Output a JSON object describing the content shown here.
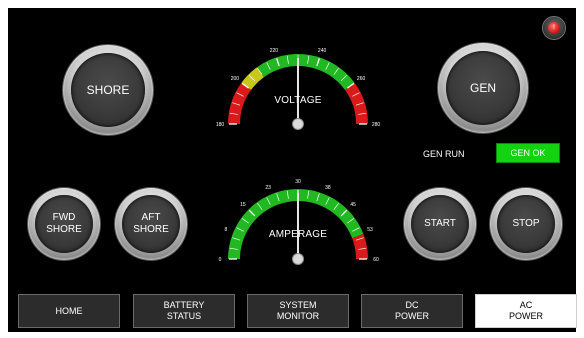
{
  "left_buttons": {
    "shore": "SHORE",
    "fwd_shore": "FWD\nSHORE",
    "aft_shore": "AFT\nSHORE"
  },
  "right_buttons": {
    "gen": "GEN",
    "start": "START",
    "stop": "STOP"
  },
  "status": {
    "gen_run_label": "GEN RUN",
    "gen_ok_badge": "GEN OK",
    "badge_color": "#12d212"
  },
  "alarm": {
    "icon": "alert-light-icon",
    "glyph": "!"
  },
  "voltage_gauge": {
    "title": "VOLTAGE",
    "min": 180,
    "max": 280,
    "ticks": [
      "180",
      "200",
      "220",
      "240",
      "260",
      "280"
    ],
    "zones": [
      {
        "from": 180,
        "to": 200,
        "color": "#d81a1a"
      },
      {
        "from": 200,
        "to": 210,
        "color": "#c8c81a"
      },
      {
        "from": 210,
        "to": 260,
        "color": "#22b822"
      },
      {
        "from": 260,
        "to": 280,
        "color": "#d81a1a"
      }
    ],
    "value": 230
  },
  "amperage_gauge": {
    "title": "AMPERAGE",
    "min": 0,
    "max": 60,
    "ticks": [
      "0",
      "8",
      "15",
      "23",
      "30",
      "38",
      "45",
      "53",
      "60"
    ],
    "zones": [
      {
        "from": 0,
        "to": 53,
        "color": "#22b822"
      },
      {
        "from": 53,
        "to": 60,
        "color": "#d81a1a"
      }
    ],
    "value": 30
  },
  "nav": {
    "home": "HOME",
    "battery_status": "BATTERY\nSTATUS",
    "system_monitor": "SYSTEM\nMONITOR",
    "dc_power": "DC\nPOWER",
    "ac_power": "AC\nPOWER",
    "active": "ac_power"
  }
}
